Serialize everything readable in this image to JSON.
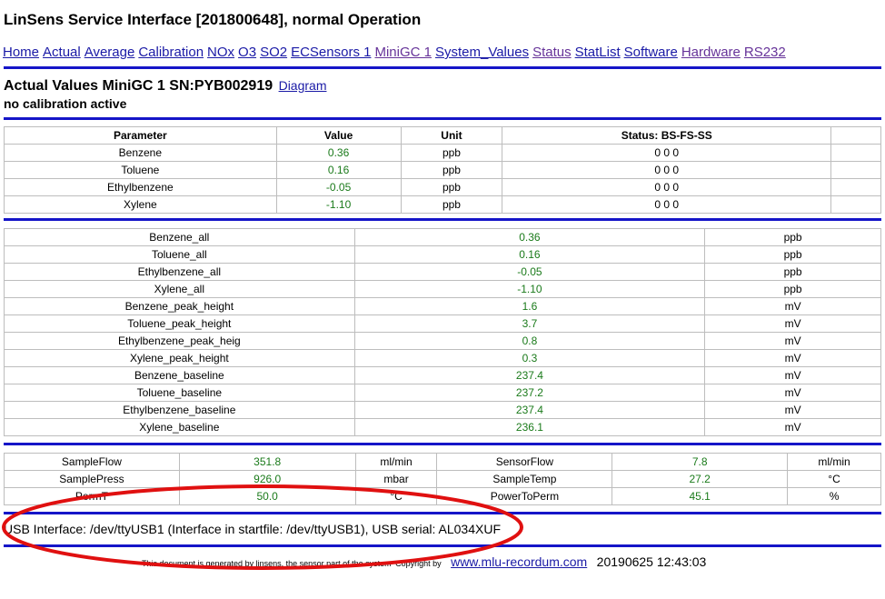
{
  "page": {
    "title": "LinSens Service Interface [201800648], normal Operation"
  },
  "nav": {
    "links": [
      "Home",
      "Actual",
      "Average",
      "Calibration",
      "NOx",
      "O3",
      "SO2",
      "ECSensors 1",
      "MiniGC 1",
      "System_Values",
      "Status",
      "StatList",
      "Software",
      "Hardware",
      "RS232"
    ]
  },
  "section": {
    "heading": "Actual Values MiniGC 1 SN:PYB002919",
    "diagram_link": "Diagram",
    "calibration_status": "no calibration active"
  },
  "table1": {
    "headers": [
      "Parameter",
      "Value",
      "Unit",
      "Status: BS-FS-SS",
      ""
    ],
    "rows": [
      [
        "Benzene",
        "0.36",
        "ppb",
        "0 0 0",
        ""
      ],
      [
        "Toluene",
        "0.16",
        "ppb",
        "0 0 0",
        ""
      ],
      [
        "Ethylbenzene",
        "-0.05",
        "ppb",
        "0 0 0",
        ""
      ],
      [
        "Xylene",
        "-1.10",
        "ppb",
        "0 0 0",
        ""
      ]
    ]
  },
  "table2": {
    "rows": [
      [
        "Benzene_all",
        "0.36",
        "ppb"
      ],
      [
        "Toluene_all",
        "0.16",
        "ppb"
      ],
      [
        "Ethylbenzene_all",
        "-0.05",
        "ppb"
      ],
      [
        "Xylene_all",
        "-1.10",
        "ppb"
      ],
      [
        "Benzene_peak_height",
        "1.6",
        "mV"
      ],
      [
        "Toluene_peak_height",
        "3.7",
        "mV"
      ],
      [
        "Ethylbenzene_peak_heig",
        "0.8",
        "mV"
      ],
      [
        "Xylene_peak_height",
        "0.3",
        "mV"
      ],
      [
        "Benzene_baseline",
        "237.4",
        "mV"
      ],
      [
        "Toluene_baseline",
        "237.2",
        "mV"
      ],
      [
        "Ethylbenzene_baseline",
        "237.4",
        "mV"
      ],
      [
        "Xylene_baseline",
        "236.1",
        "mV"
      ]
    ]
  },
  "table3": {
    "rows": [
      [
        "SampleFlow",
        "351.8",
        "ml/min",
        "SensorFlow",
        "7.8",
        "ml/min"
      ],
      [
        "SamplePress",
        "926.0",
        "mbar",
        "SampleTemp",
        "27.2",
        "°C"
      ],
      [
        "PermT",
        "50.0",
        "°C",
        "PowerToPerm",
        "45.1",
        "%"
      ]
    ]
  },
  "usb_line": "USB Interface: /dev/ttyUSB1 (Interface in startfile: /dev/ttyUSB1), USB serial: AL034XUF",
  "footer": {
    "note": "This document is generated by linsens, the sensor part of the system",
    "copyright": "Copyright by",
    "link": "www.mlu-recordum.com",
    "timestamp": "20190625 12:43:03"
  },
  "colors": {
    "link": "#1a1aa6",
    "value_green": "#1a7a1a",
    "rule_blue": "#1515c8",
    "annotation_red": "#e01010"
  }
}
